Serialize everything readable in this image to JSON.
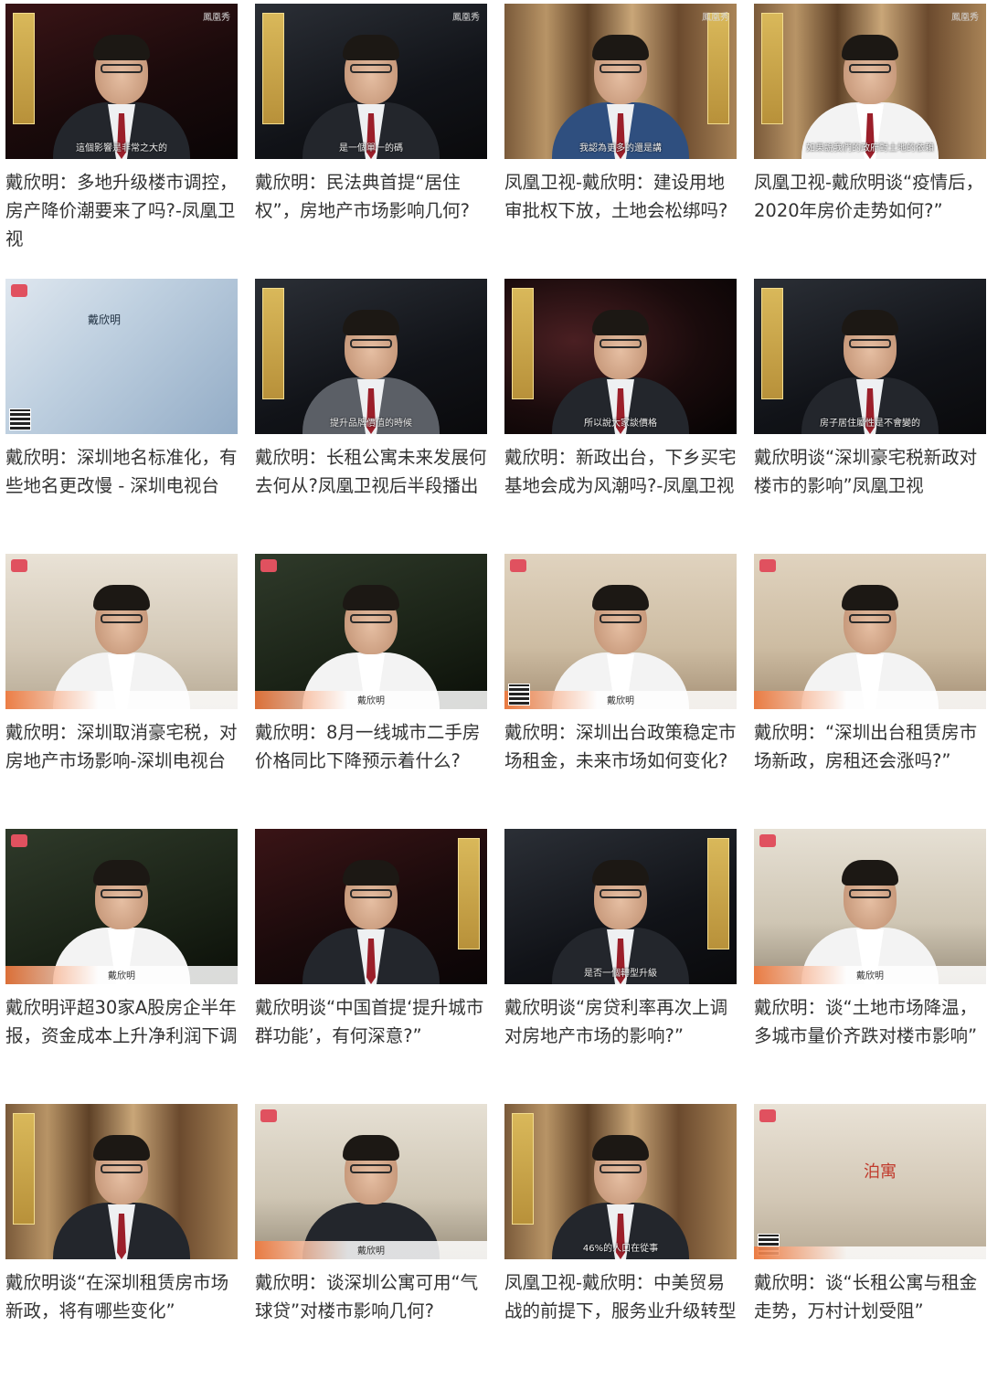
{
  "videos": [
    {
      "title": "戴欣明：多地升级楼市调控，房产降价潮要来了吗?-凤凰卫视",
      "overlay": "這個影響是非常之大的",
      "logo": "鳳凰秀"
    },
    {
      "title": "戴欣明：民法典首提“居住权”，房地产市场影响几何?",
      "overlay": "是一個單一的碼",
      "logo": "鳳凰秀"
    },
    {
      "title": "凤凰卫视-戴欣明：建设用地审批权下放，土地会松绑吗?",
      "overlay": "我認為更多的還是講",
      "logo": "鳳凰秀"
    },
    {
      "title": "凤凰卫视-戴欣明谈“疫情后，2020年房价走势如何?”",
      "overlay": "如果說我們的政府對土地的依賴",
      "logo": "鳳凰秀"
    },
    {
      "title": "戴欣明：深圳地名标准化，有些地名更改慢 - 深圳电视台",
      "overlay": "戴欣明",
      "logo": ""
    },
    {
      "title": "戴欣明：长租公寓未来发展何去何从?凤凰卫视后半段播出",
      "overlay": "提升品牌價值的時候",
      "logo": ""
    },
    {
      "title": "戴欣明：新政出台，下乡买宅基地会成为风潮吗?-凤凰卫视",
      "overlay": "所以說大家談價格",
      "logo": ""
    },
    {
      "title": "戴欣明谈“深圳豪宅税新政对楼市的影响”凤凰卫视",
      "overlay": "房子居住屬性是不會變的",
      "logo": ""
    },
    {
      "title": "戴欣明：深圳取消豪宅税，对房地产市场影响-深圳电视台",
      "overlay": "",
      "logo": ""
    },
    {
      "title": "戴欣明：8月一线城市二手房价格同比下降预示着什么?",
      "overlay": "戴欣明",
      "logo": ""
    },
    {
      "title": "戴欣明：深圳出台政策稳定市场租金，未来市场如何变化?",
      "overlay": "戴欣明",
      "logo": ""
    },
    {
      "title": "戴欣明：“深圳出台租赁房市场新政，房租还会涨吗?”",
      "overlay": "",
      "logo": ""
    },
    {
      "title": "戴欣明评超30家A股房企半年报，资金成本上升净利润下调",
      "overlay": "戴欣明",
      "logo": ""
    },
    {
      "title": "戴欣明谈“中国首提‘提升城市群功能’，有何深意?”",
      "overlay": "",
      "logo": ""
    },
    {
      "title": "戴欣明谈“房贷利率再次上调对房地产市场的影响?”",
      "overlay": "是否一個轉型升級",
      "logo": ""
    },
    {
      "title": "戴欣明：谈“土地市场降温，多城市量价齐跌对楼市影响”",
      "overlay": "戴欣明",
      "logo": ""
    },
    {
      "title": "戴欣明谈“在深圳租赁房市场新政，将有哪些变化”",
      "overlay": "",
      "logo": ""
    },
    {
      "title": "戴欣明：谈深圳公寓可用“气球贷”对楼市影响几何?",
      "overlay": "戴欣明",
      "logo": ""
    },
    {
      "title": "凤凰卫视-戴欣明：中美贸易战的前提下，服务业升级转型",
      "overlay": "46%的人口在從事",
      "logo": ""
    },
    {
      "title": "戴欣明：谈“长租公寓与租金走势，万村计划受阻”",
      "overlay": "泊寓",
      "logo": ""
    }
  ]
}
